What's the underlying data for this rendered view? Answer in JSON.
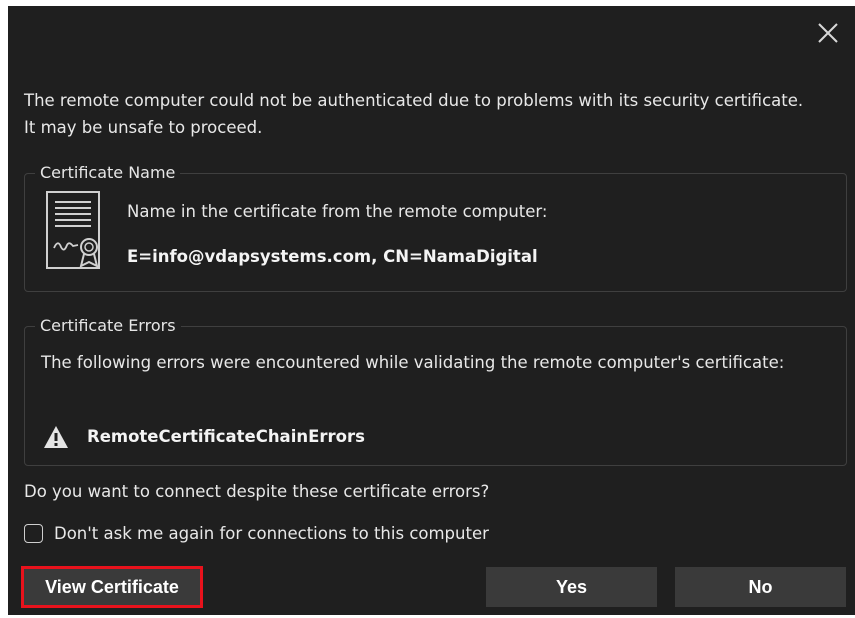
{
  "dialog": {
    "intro": "The remote computer could not be authenticated due to problems with its security certificate. It may be unsafe to proceed.",
    "certificate_name": {
      "legend": "Certificate Name",
      "description": "Name in the certificate from the remote computer:",
      "value": "E=info@vdapsystems.com, CN=NamaDigital",
      "icon": "certificate-icon"
    },
    "certificate_errors": {
      "legend": "Certificate Errors",
      "description": "The following errors were encountered while validating the remote computer's certificate:",
      "error": "RemoteCertificateChainErrors",
      "icon": "warning-icon"
    },
    "question": "Do you want to connect despite these certificate errors?",
    "checkbox": {
      "label": "Don't ask me again for connections to this computer",
      "checked": false
    },
    "buttons": {
      "view_certificate": "View Certificate",
      "yes": "Yes",
      "no": "No"
    },
    "highlight_color": "#e8121c",
    "background_color": "#1f1f1f"
  }
}
